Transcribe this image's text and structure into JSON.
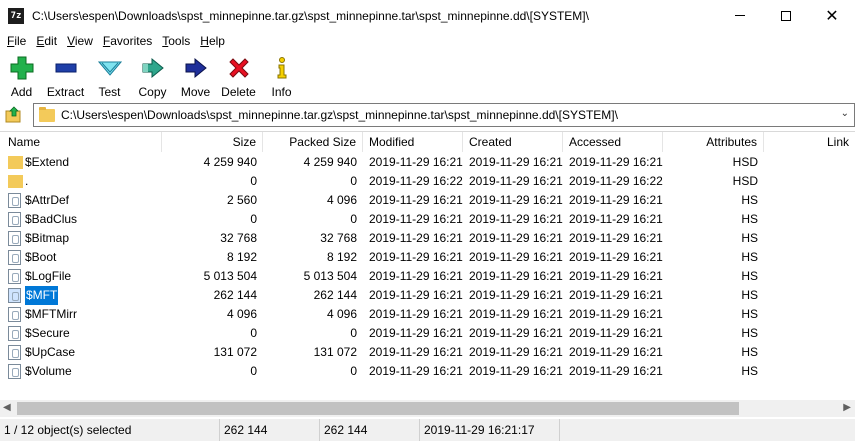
{
  "window": {
    "app_icon_text": "7z",
    "title": "C:\\Users\\espen\\Downloads\\spst_minnepinne.tar.gz\\spst_minnepinne.tar\\spst_minnepinne.dd\\[SYSTEM]\\",
    "close_glyph": "✕"
  },
  "menu": [
    {
      "ul": "F",
      "rest": "ile"
    },
    {
      "ul": "E",
      "rest": "dit"
    },
    {
      "ul": "V",
      "rest": "iew"
    },
    {
      "ul": "F",
      "rest": "avorites",
      "pre": ""
    },
    {
      "ul": "T",
      "rest": "ools"
    },
    {
      "ul": "H",
      "rest": "elp"
    }
  ],
  "menu_labels": [
    "File",
    "Edit",
    "View",
    "Favorites",
    "Tools",
    "Help"
  ],
  "toolbar": {
    "add": "Add",
    "extract": "Extract",
    "test": "Test",
    "copy": "Copy",
    "move": "Move",
    "delete": "Delete",
    "info": "Info"
  },
  "icons": {
    "add": "plus-icon",
    "extract": "minus-icon",
    "test": "check-chevron-icon",
    "copy": "copy-arrow-icon",
    "move": "move-arrow-icon",
    "delete": "x-icon",
    "info": "info-icon"
  },
  "address": {
    "path": "C:\\Users\\espen\\Downloads\\spst_minnepinne.tar.gz\\spst_minnepinne.tar\\spst_minnepinne.dd\\[SYSTEM]\\",
    "dropdown_glyph": "⌄"
  },
  "columns": {
    "name": "Name",
    "size": "Size",
    "packed": "Packed Size",
    "modified": "Modified",
    "created": "Created",
    "accessed": "Accessed",
    "attributes": "Attributes",
    "link": "Link"
  },
  "rows": [
    {
      "name": "$Extend",
      "type": "folder",
      "size": "4 259 940",
      "packed": "4 259 940",
      "modified": "2019-11-29 16:21",
      "created": "2019-11-29 16:21",
      "accessed": "2019-11-29 16:21",
      "attributes": "HSD",
      "selected": false
    },
    {
      "name": ".",
      "type": "folder",
      "size": "0",
      "packed": "0",
      "modified": "2019-11-29 16:22",
      "created": "2019-11-29 16:21",
      "accessed": "2019-11-29 16:22",
      "attributes": "HSD",
      "selected": false
    },
    {
      "name": "$AttrDef",
      "type": "file",
      "size": "2 560",
      "packed": "4 096",
      "modified": "2019-11-29 16:21",
      "created": "2019-11-29 16:21",
      "accessed": "2019-11-29 16:21",
      "attributes": "HS",
      "selected": false
    },
    {
      "name": "$BadClus",
      "type": "file",
      "size": "0",
      "packed": "0",
      "modified": "2019-11-29 16:21",
      "created": "2019-11-29 16:21",
      "accessed": "2019-11-29 16:21",
      "attributes": "HS",
      "selected": false
    },
    {
      "name": "$Bitmap",
      "type": "file",
      "size": "32 768",
      "packed": "32 768",
      "modified": "2019-11-29 16:21",
      "created": "2019-11-29 16:21",
      "accessed": "2019-11-29 16:21",
      "attributes": "HS",
      "selected": false
    },
    {
      "name": "$Boot",
      "type": "file",
      "size": "8 192",
      "packed": "8 192",
      "modified": "2019-11-29 16:21",
      "created": "2019-11-29 16:21",
      "accessed": "2019-11-29 16:21",
      "attributes": "HS",
      "selected": false
    },
    {
      "name": "$LogFile",
      "type": "file",
      "size": "5 013 504",
      "packed": "5 013 504",
      "modified": "2019-11-29 16:21",
      "created": "2019-11-29 16:21",
      "accessed": "2019-11-29 16:21",
      "attributes": "HS",
      "selected": false
    },
    {
      "name": "$MFT",
      "type": "file",
      "size": "262 144",
      "packed": "262 144",
      "modified": "2019-11-29 16:21",
      "created": "2019-11-29 16:21",
      "accessed": "2019-11-29 16:21",
      "attributes": "HS",
      "selected": true
    },
    {
      "name": "$MFTMirr",
      "type": "file",
      "size": "4 096",
      "packed": "4 096",
      "modified": "2019-11-29 16:21",
      "created": "2019-11-29 16:21",
      "accessed": "2019-11-29 16:21",
      "attributes": "HS",
      "selected": false
    },
    {
      "name": "$Secure",
      "type": "file",
      "size": "0",
      "packed": "0",
      "modified": "2019-11-29 16:21",
      "created": "2019-11-29 16:21",
      "accessed": "2019-11-29 16:21",
      "attributes": "HS",
      "selected": false
    },
    {
      "name": "$UpCase",
      "type": "file",
      "size": "131 072",
      "packed": "131 072",
      "modified": "2019-11-29 16:21",
      "created": "2019-11-29 16:21",
      "accessed": "2019-11-29 16:21",
      "attributes": "HS",
      "selected": false
    },
    {
      "name": "$Volume",
      "type": "file",
      "size": "0",
      "packed": "0",
      "modified": "2019-11-29 16:21",
      "created": "2019-11-29 16:21",
      "accessed": "2019-11-29 16:21",
      "attributes": "HS",
      "selected": false
    }
  ],
  "scrollbar": {
    "left_glyph": "◀",
    "right_glyph": "▶"
  },
  "status": {
    "selection": "1 / 12 object(s) selected",
    "size": "262 144",
    "packed": "262 144",
    "modified": "2019-11-29 16:21:17"
  },
  "colors": {
    "selection": "#0078d7",
    "folder": "#f3ca5a",
    "add_green": "#22b14c",
    "delete_red": "#e81123"
  }
}
